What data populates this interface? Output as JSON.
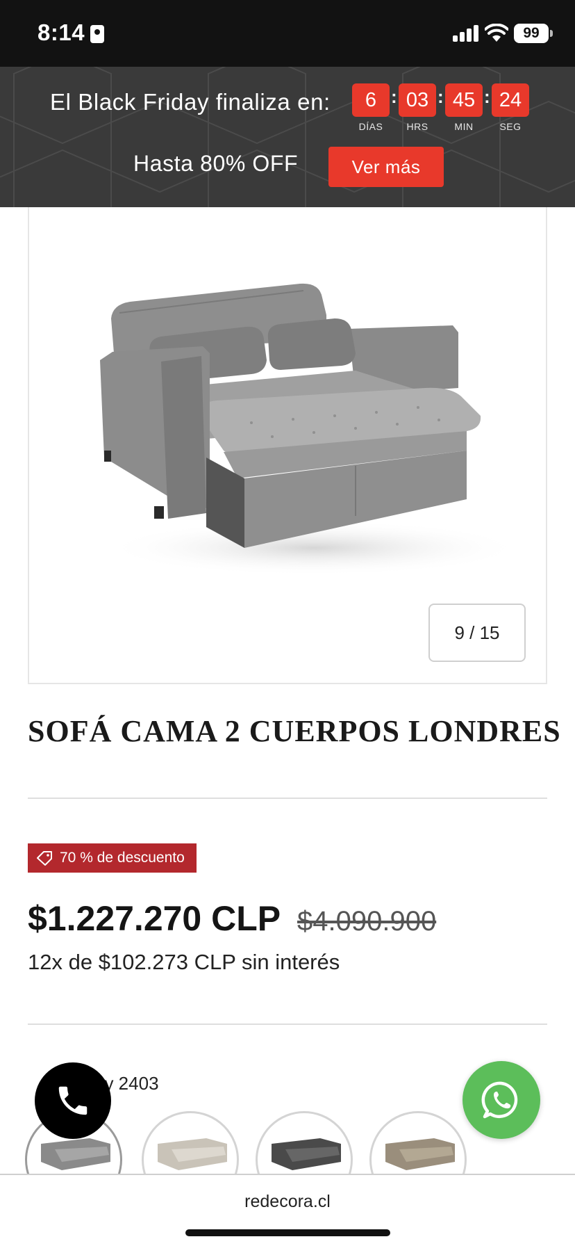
{
  "status_bar": {
    "time": "8:14",
    "battery": "99"
  },
  "promo": {
    "title": "El Black Friday finaliza en:",
    "countdown": [
      {
        "value": "6",
        "label": "DÍAS"
      },
      {
        "value": "03",
        "label": "HRS"
      },
      {
        "value": "45",
        "label": "MIN"
      },
      {
        "value": "24",
        "label": "SEG"
      }
    ],
    "subtitle": "Hasta 80% OFF",
    "button": "Ver más",
    "accent_color": "#e8392b"
  },
  "gallery": {
    "counter": "9 / 15"
  },
  "product": {
    "title": "SOFÁ CAMA 2 CUERPOS LONDRES",
    "discount_badge": "70 % de descuento",
    "price": "$1.227.270 CLP",
    "price_old": "$4.090.900",
    "installments": "12x de $102.273 CLP sin interés",
    "color_label": "Color: Gray 2403",
    "color_visible_text": "ay 2403",
    "swatches": [
      {
        "name": "Gray 2403",
        "color": "#8a8a8a",
        "selected": true
      },
      {
        "name": "Beige",
        "color": "#c9c3b8",
        "selected": false
      },
      {
        "name": "Charcoal",
        "color": "#4a4a4a",
        "selected": false
      },
      {
        "name": "Taupe",
        "color": "#9a8e7c",
        "selected": false
      }
    ]
  },
  "floating": {
    "phone_icon": "phone-icon",
    "whatsapp_icon": "whatsapp-icon"
  },
  "browser": {
    "url": "redecora.cl"
  }
}
